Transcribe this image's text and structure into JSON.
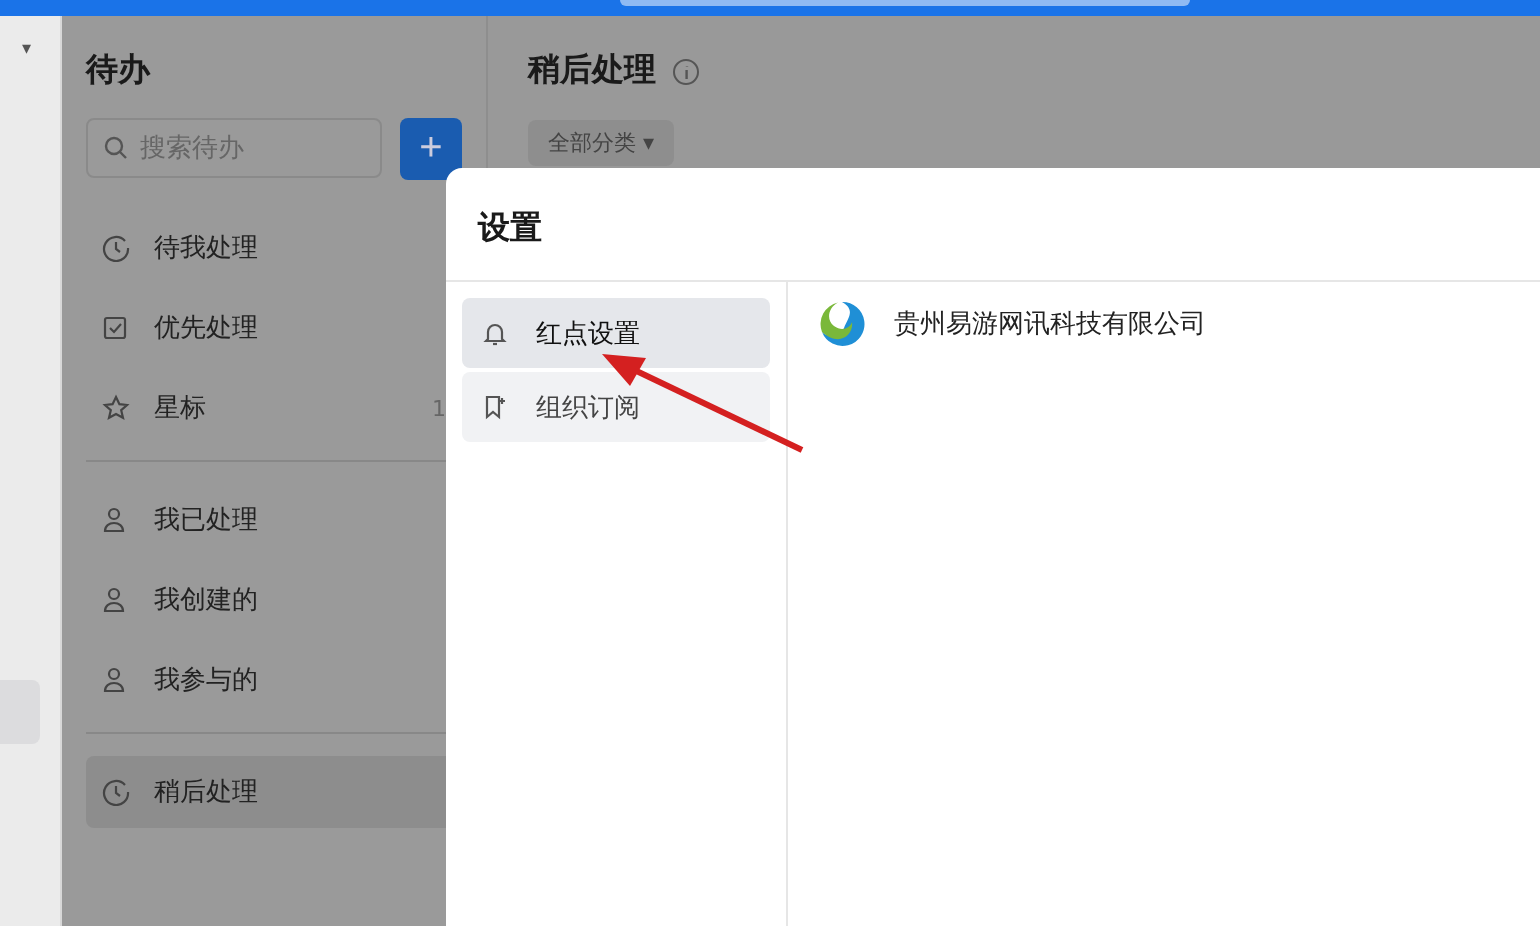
{
  "left_strip": {
    "dropdown_caret": "▾"
  },
  "todo_panel": {
    "title": "待办",
    "search": {
      "placeholder": "搜索待办"
    },
    "add_button": "+",
    "groups": [
      [
        {
          "label": "待我处理",
          "selected": false
        },
        {
          "label": "优先处理",
          "selected": false
        },
        {
          "label": "星标",
          "count": "1",
          "selected": false
        }
      ],
      [
        {
          "label": "我已处理",
          "selected": false
        },
        {
          "label": "我创建的",
          "selected": false
        },
        {
          "label": "我参与的",
          "selected": false
        }
      ],
      [
        {
          "label": "稍后处理",
          "selected": true
        }
      ]
    ]
  },
  "main": {
    "title": "稍后处理",
    "filter": "全部分类",
    "filter_caret": "▾"
  },
  "settings_dialog": {
    "title": "设置",
    "menu": [
      {
        "label": "红点设置",
        "selected": true,
        "hovered": false
      },
      {
        "label": "组织订阅",
        "selected": false,
        "hovered": true
      }
    ],
    "organizations": [
      {
        "name": "贵州易游网讯科技有限公司"
      }
    ]
  }
}
